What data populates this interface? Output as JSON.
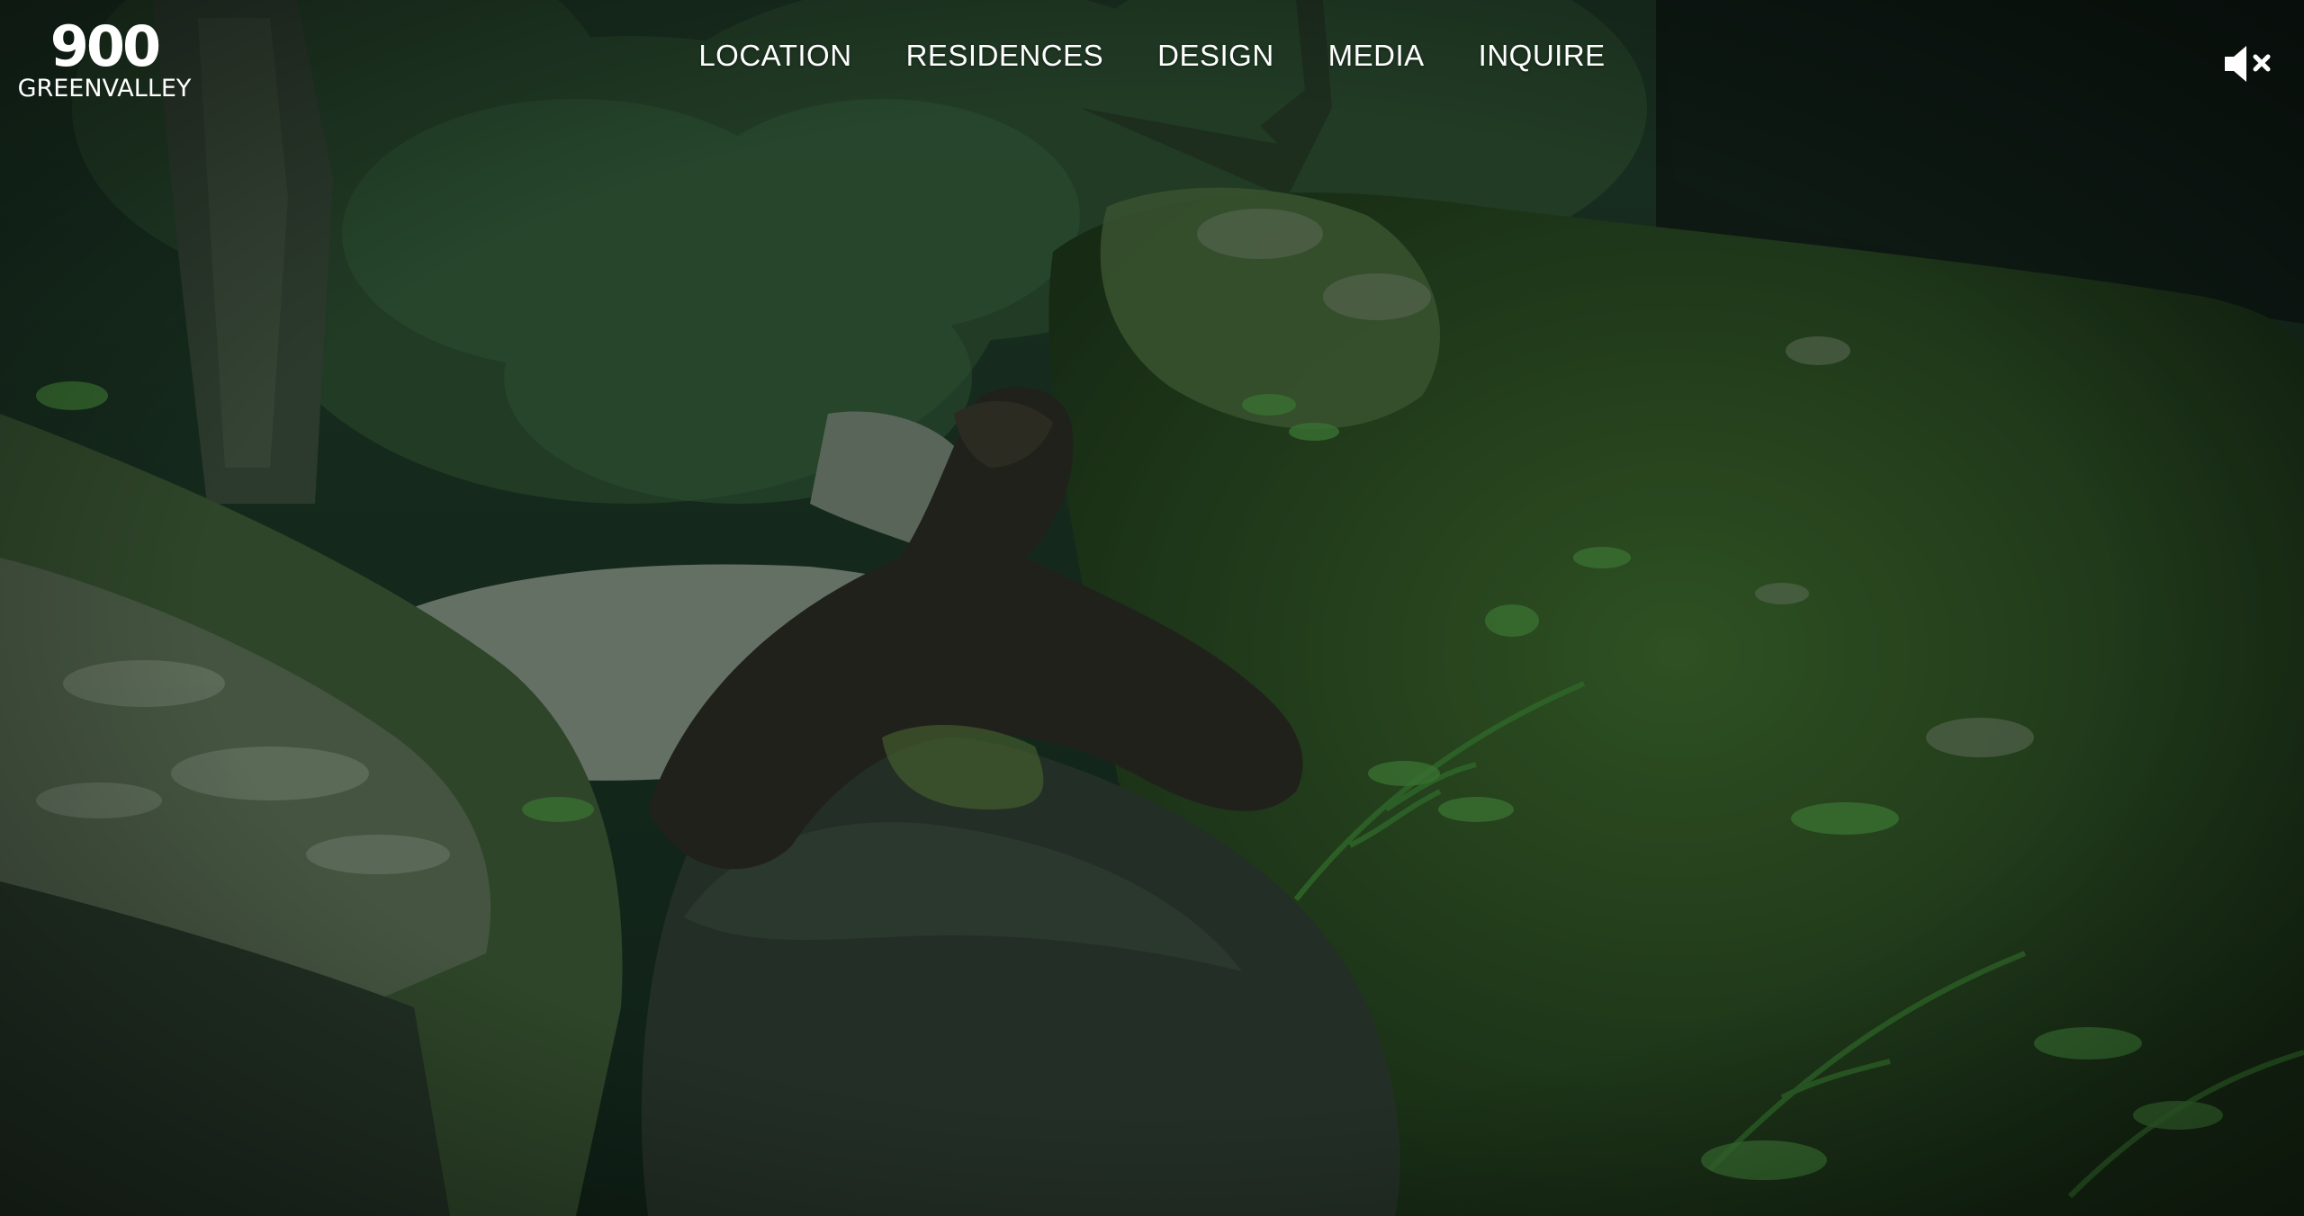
{
  "brand": {
    "number": "900",
    "name": "GREENVALLEY"
  },
  "nav": {
    "items": [
      {
        "label": "LOCATION"
      },
      {
        "label": "RESIDENCES"
      },
      {
        "label": "DESIGN"
      },
      {
        "label": "MEDIA"
      },
      {
        "label": "INQUIRE"
      }
    ]
  },
  "audio": {
    "icon": "speaker-muted-icon",
    "state": "muted"
  },
  "colors": {
    "nav_text": "#ffffff",
    "overlay": "#0b1a12"
  }
}
